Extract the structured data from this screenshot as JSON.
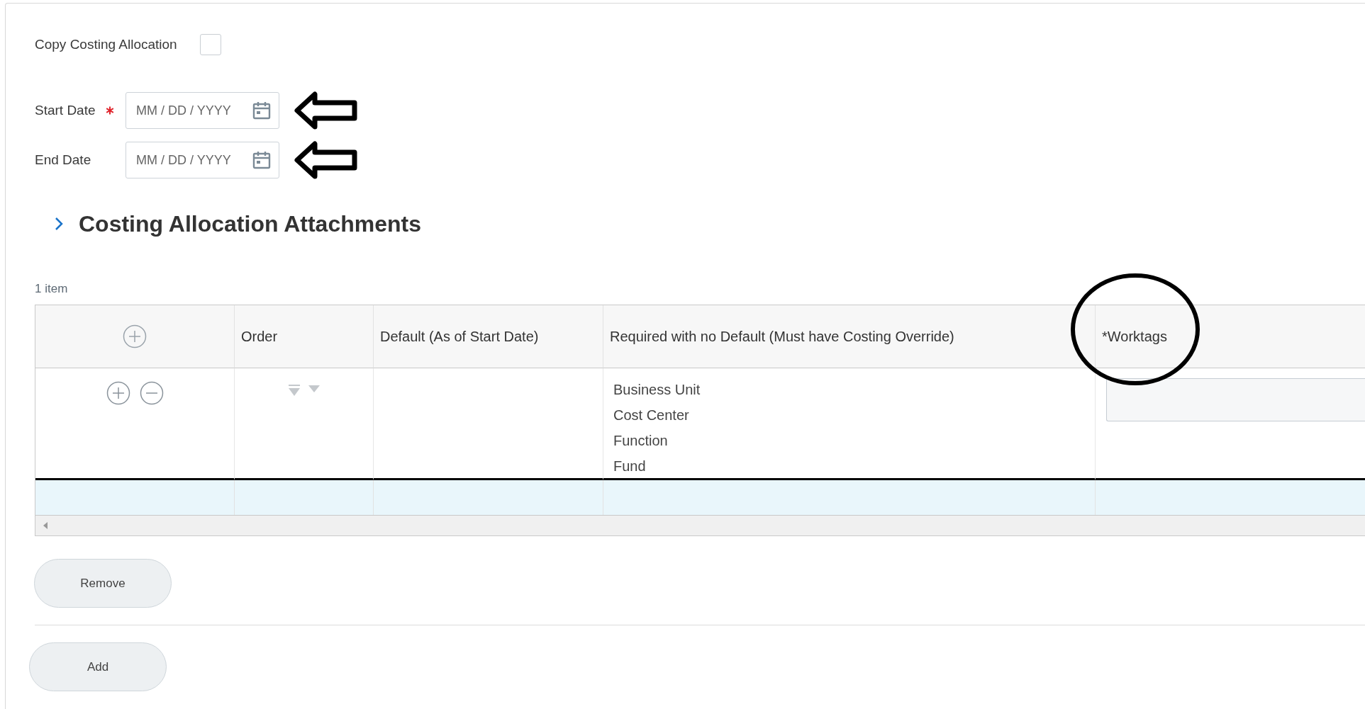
{
  "copy_costing_allocation": {
    "label": "Copy Costing Allocation",
    "checked": false
  },
  "date_fields": [
    {
      "label": "Start Date",
      "required": true,
      "placeholder": "MM / DD / YYYY"
    },
    {
      "label": "End Date",
      "required": false,
      "placeholder": "MM / DD / YYYY"
    }
  ],
  "section": {
    "title": "Costing Allocation Attachments",
    "expanded": false
  },
  "item_count": "1 item",
  "table": {
    "columns": [
      "Order",
      "Default (As of Start Date)",
      "Required with no Default (Must have Costing Override)",
      "*Worktags"
    ],
    "rows": [
      {
        "required_with_no_default": [
          "Business Unit",
          "Cost Center",
          "Function",
          "Fund"
        ]
      }
    ]
  },
  "buttons": [
    "Remove",
    "Add"
  ]
}
